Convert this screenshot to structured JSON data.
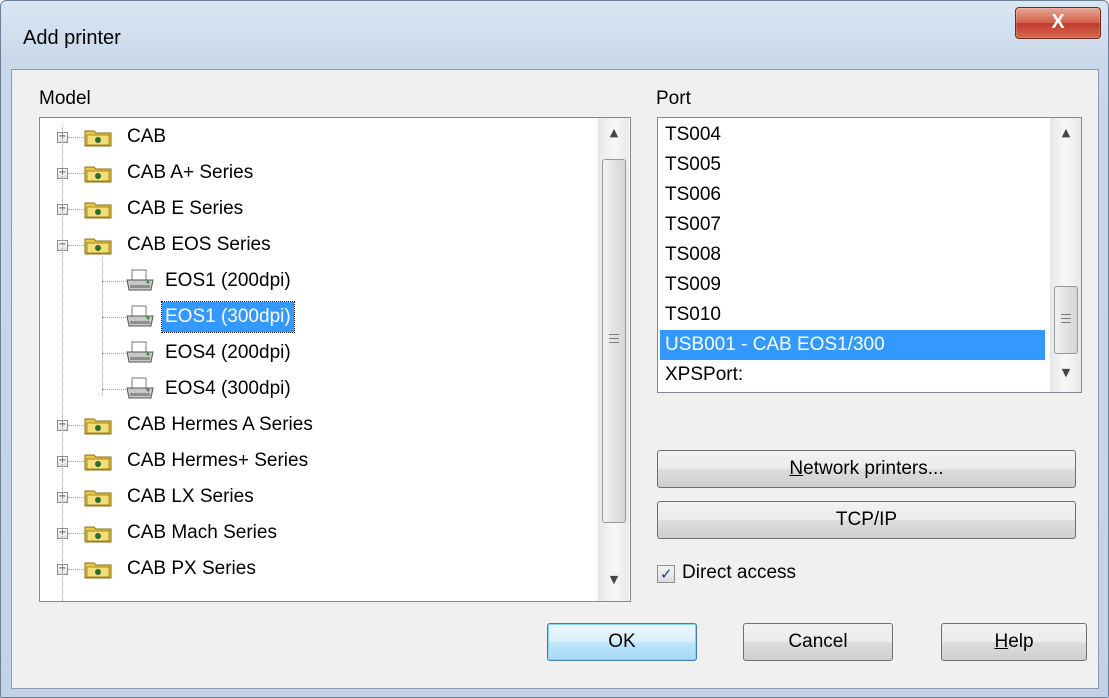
{
  "window": {
    "title": "Add printer",
    "close_glyph": "X"
  },
  "model": {
    "label": "Model",
    "tree": [
      {
        "label": "CAB",
        "type": "folder",
        "expanded": false
      },
      {
        "label": "CAB A+ Series",
        "type": "folder",
        "expanded": false
      },
      {
        "label": "CAB E Series",
        "type": "folder",
        "expanded": false
      },
      {
        "label": "CAB EOS Series",
        "type": "folder",
        "expanded": true
      },
      {
        "label": "EOS1 (200dpi)",
        "type": "printer"
      },
      {
        "label": "EOS1 (300dpi)",
        "type": "printer",
        "selected": true
      },
      {
        "label": "EOS4 (200dpi)",
        "type": "printer"
      },
      {
        "label": "EOS4 (300dpi)",
        "type": "printer"
      },
      {
        "label": "CAB Hermes A Series",
        "type": "folder",
        "expanded": false
      },
      {
        "label": "CAB Hermes+ Series",
        "type": "folder",
        "expanded": false
      },
      {
        "label": "CAB LX Series",
        "type": "folder",
        "expanded": false
      },
      {
        "label": "CAB Mach Series",
        "type": "folder",
        "expanded": false
      },
      {
        "label": "CAB PX Series",
        "type": "folder",
        "expanded": false
      }
    ]
  },
  "port": {
    "label": "Port",
    "items": [
      "TS004",
      "TS005",
      "TS006",
      "TS007",
      "TS008",
      "TS009",
      "TS010",
      "USB001 - CAB EOS1/300",
      "XPSPort:"
    ],
    "selected": "USB001 - CAB EOS1/300"
  },
  "buttons": {
    "network_printers": {
      "mnemonic": "N",
      "rest": "etwork printers..."
    },
    "tcpip": "TCP/IP",
    "ok": "OK",
    "cancel": "Cancel",
    "help": {
      "mnemonic": "H",
      "rest": "elp"
    }
  },
  "direct_access": {
    "label": "Direct access",
    "checked": true
  },
  "colors": {
    "selection": "#3399ff",
    "dialog_bg": "#f0f0f0",
    "close_button": "#c0392b"
  }
}
